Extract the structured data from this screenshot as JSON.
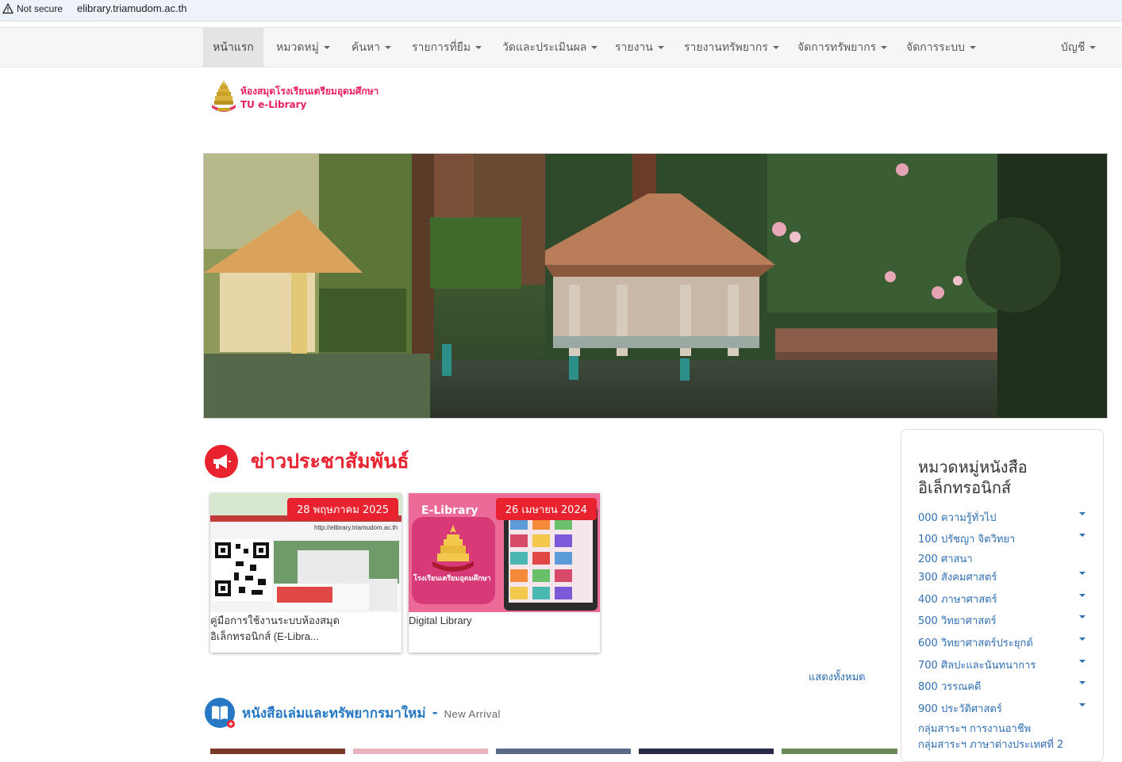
{
  "browser": {
    "security_label": "Not secure",
    "url": "elibrary.triamudom.ac.th"
  },
  "nav": {
    "items": [
      {
        "label": "หน้าแรก",
        "has_caret": false,
        "active": true
      },
      {
        "label": "หมวดหมู่",
        "has_caret": true
      },
      {
        "label": "ค้นหา",
        "has_caret": true
      },
      {
        "label": "รายการที่ยืม",
        "has_caret": true
      },
      {
        "label": "วัดและประเมินผล",
        "has_caret": true
      },
      {
        "label": "รายงาน",
        "has_caret": true
      },
      {
        "label": "รายงานทรัพยากร",
        "has_caret": true
      },
      {
        "label": "จัดการทรัพยากร",
        "has_caret": true
      },
      {
        "label": "จัดการระบบ",
        "has_caret": true
      }
    ],
    "account_label": "บัญชี"
  },
  "logo": {
    "title": "ห้องสมุดโรงเรียนเตรียมอุดมศึกษา",
    "subtitle": "TU e-Library"
  },
  "news": {
    "heading": "ข่าวประชาสัมพันธ์",
    "cards": [
      {
        "date": "28 พฤษภาคม 2025",
        "title_line1": "คู่มือการใช้งานระบบห้องสมุด",
        "title_line2": "อิเล็กทรอนิกส์ (E-Libra...",
        "image_url_text": "http://elibrary.triamudom.ac.th"
      },
      {
        "date": "26 เมษายน 2024",
        "title_line1": "Digital Library",
        "image_label": "E-Library",
        "image_school": "โรงเรียนเตรียมอุดมศึกษา"
      }
    ],
    "show_all": "แสดงทั้งหมด"
  },
  "new_arrival": {
    "title": "หนังสือเล่มและทรัพยากรมาใหม่",
    "separator": "-",
    "subtitle": "New Arrival"
  },
  "sidebar": {
    "title": "หมวดหมู่หนังสืออิเล็กทรอนิกส์",
    "categories": [
      {
        "label": "000 ความรู้ทั่วไป",
        "expandable": true
      },
      {
        "label": "100 ปรัชญา จิตวิทยา",
        "expandable": true
      },
      {
        "label": "200 ศาสนา",
        "expandable": false
      },
      {
        "label": "300 สังคมศาสตร์",
        "expandable": true
      },
      {
        "label": "400 ภาษาศาสตร์",
        "expandable": true
      },
      {
        "label": "500 วิทยาศาสตร์",
        "expandable": true
      },
      {
        "label": "600 วิทยาศาสตร์ประยุกต์",
        "expandable": true
      },
      {
        "label": "700 ศิลปะและนันทนาการ",
        "expandable": true
      },
      {
        "label": "800 วรรณคดี",
        "expandable": true
      },
      {
        "label": "900 ประวัติศาสตร์",
        "expandable": true
      },
      {
        "label": "กลุ่มสาระฯ การงานอาชีพ",
        "expandable": false
      },
      {
        "label": "กลุ่มสาระฯ ภาษาต่างประเทศที่ 2",
        "expandable": false
      }
    ]
  },
  "colors": {
    "accent_red": "#e8232f",
    "accent_blue": "#2778c4",
    "logo_pink": "#e91e63"
  }
}
